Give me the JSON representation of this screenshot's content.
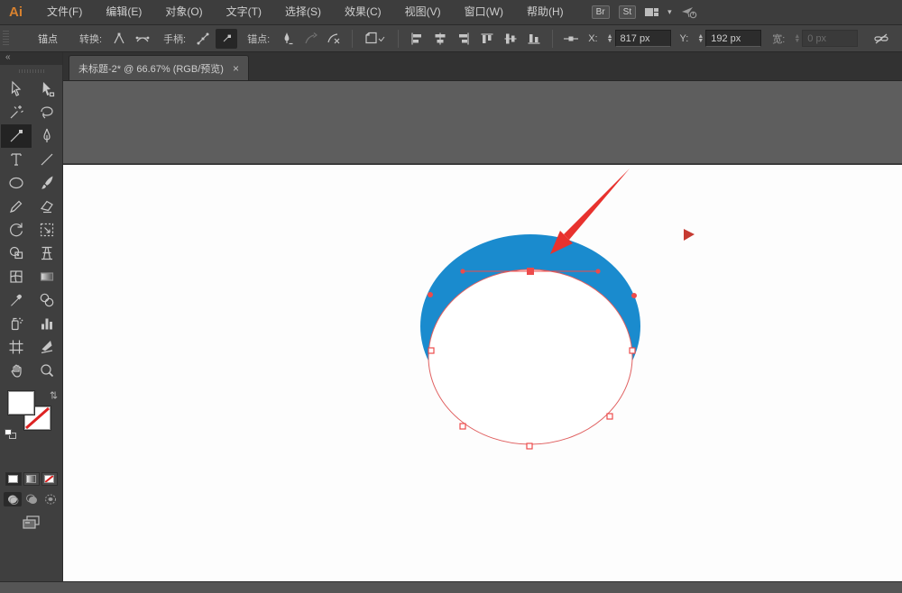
{
  "menu_bar": {
    "logo": "Ai",
    "items": [
      "文件(F)",
      "编辑(E)",
      "对象(O)",
      "文字(T)",
      "选择(S)",
      "效果(C)",
      "视图(V)",
      "窗口(W)",
      "帮助(H)"
    ],
    "badges": [
      "Br",
      "St"
    ],
    "icons": [
      "workspace-switcher-icon",
      "chevron-down-icon",
      "share-icon"
    ]
  },
  "control_bar": {
    "mode_label": "锚点",
    "convert_label": "转换:",
    "handles_label": "手柄:",
    "anchors_label": "锚点:",
    "x_label": "X:",
    "x_value": "817 px",
    "y_label": "Y:",
    "y_value": "192 px",
    "w_label": "宽:",
    "w_value": "0 px",
    "icons": [
      "convert-corner-icon",
      "convert-smooth-icon",
      "handles-show-icon",
      "handles-hide-icon",
      "remove-anchor-icon",
      "connect-path-icon",
      "cut-path-icon",
      "isolate-object-icon",
      "align-left-icon",
      "align-center-h-icon",
      "align-right-icon",
      "align-top-icon",
      "align-middle-v-icon",
      "align-bottom-icon",
      "transform-reference-icon",
      "link-dimensions-icon"
    ]
  },
  "document_tab": {
    "title": "未标题-2* @ 66.67% (RGB/预览)",
    "close": "×"
  },
  "toolbar": {
    "collapse": "«",
    "tools": [
      {
        "name": "selection-tool",
        "selected": false
      },
      {
        "name": "direct-selection-tool",
        "selected": false
      },
      {
        "name": "magic-wand-tool",
        "selected": false
      },
      {
        "name": "lasso-tool",
        "selected": false
      },
      {
        "name": "anchor-point-tool",
        "selected": true
      },
      {
        "name": "pen-tool",
        "selected": false
      },
      {
        "name": "type-tool",
        "selected": false
      },
      {
        "name": "line-segment-tool",
        "selected": false
      },
      {
        "name": "ellipse-tool",
        "selected": false
      },
      {
        "name": "paintbrush-tool",
        "selected": false
      },
      {
        "name": "pencil-tool",
        "selected": false
      },
      {
        "name": "eraser-tool",
        "selected": false
      },
      {
        "name": "rotate-tool",
        "selected": false
      },
      {
        "name": "free-transform-tool",
        "selected": false
      },
      {
        "name": "shape-builder-tool",
        "selected": false
      },
      {
        "name": "perspective-grid-tool",
        "selected": false
      },
      {
        "name": "mesh-tool",
        "selected": false
      },
      {
        "name": "gradient-tool",
        "selected": false
      },
      {
        "name": "eyedropper-tool",
        "selected": false
      },
      {
        "name": "blend-tool",
        "selected": false
      },
      {
        "name": "symbol-sprayer-tool",
        "selected": false
      },
      {
        "name": "column-graph-tool",
        "selected": false
      },
      {
        "name": "artboard-tool",
        "selected": false
      },
      {
        "name": "slice-tool",
        "selected": false
      },
      {
        "name": "hand-tool",
        "selected": false
      },
      {
        "name": "zoom-tool",
        "selected": false
      }
    ]
  },
  "canvas": {
    "zoom_level": "66.67%",
    "shape_fill_color": "#1a8bce",
    "path_stroke_color": "#e06060",
    "anchor_color": "#ed4b4b",
    "annotation_arrow_color": "#e8322e",
    "marker_color": "#c63a32"
  }
}
